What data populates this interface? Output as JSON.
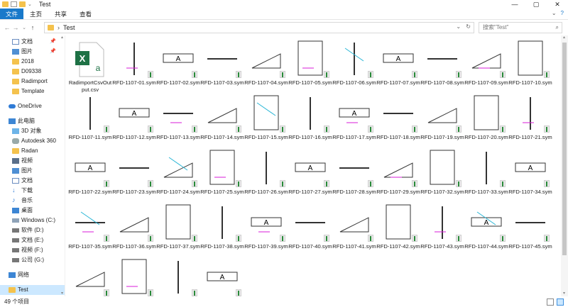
{
  "window": {
    "title": "Test",
    "controls": [
      "—",
      "▢",
      "✕"
    ]
  },
  "ribbon": {
    "tabs": [
      "文件",
      "主页",
      "共享",
      "查看"
    ],
    "right": [
      "⌄",
      "?"
    ]
  },
  "address": {
    "back": "←",
    "forward": "→",
    "history": "⌄",
    "up": "↑",
    "sep": "›",
    "path": "Test",
    "dropdown": "⌄",
    "refresh": "↻"
  },
  "search": {
    "placeholder": "搜索\"Test\"",
    "icon": "search-icon"
  },
  "sidebar": {
    "quick": [
      {
        "label": "文档",
        "pinned": true
      },
      {
        "label": "图片",
        "pinned": true
      },
      {
        "label": "2018"
      },
      {
        "label": "D09338"
      },
      {
        "label": "Radimport"
      },
      {
        "label": "Template"
      }
    ],
    "onedrive": "OneDrive",
    "pc": "此电脑",
    "pc_items": [
      "3D 对象",
      "Autodesk 360",
      "Radan",
      "视频",
      "图片",
      "文档",
      "下载",
      "音乐",
      "桌面",
      "Windows (C:)",
      "软件 (D:)",
      "文档 (E:)",
      "视频 (F:)",
      "公司 (G:)"
    ],
    "network": "网络",
    "selected": "Test"
  },
  "files": [
    "RadimportCsvOutput.csv",
    "RFD-1107-01.sym",
    "RFD-1107-02.sym",
    "RFD-1107-03.sym",
    "RFD-1107-04.sym",
    "RFD-1107-05.sym",
    "RFD-1107-06.sym",
    "RFD-1107-07.sym",
    "RFD-1107-08.sym",
    "RFD-1107-09.sym",
    "RFD-1107-10.sym",
    "RFD-1107-11.sym",
    "RFD-1107-12.sym",
    "RFD-1107-13.sym",
    "RFD-1107-14.sym",
    "RFD-1107-15.sym",
    "RFD-1107-16.sym",
    "RFD-1107-17.sym",
    "RFD-1107-18.sym",
    "RFD-1107-19.sym",
    "RFD-1107-20.sym",
    "RFD-1107-21.sym",
    "RFD-1107-22.sym",
    "RFD-1107-23.sym",
    "RFD-1107-24.sym",
    "RFD-1107-25.sym",
    "RFD-1107-26.sym",
    "RFD-1107-27.sym",
    "RFD-1107-28.sym",
    "RFD-1107-29.sym",
    "RFD-1107-32.sym",
    "RFD-1107-33.sym",
    "RFD-1107-34.sym",
    "RFD-1107-35.sym",
    "RFD-1107-36.sym",
    "RFD-1107-37.sym",
    "RFD-1107-38.sym",
    "RFD-1107-39.sym",
    "RFD-1107-40.sym",
    "RFD-1107-41.sym",
    "RFD-1107-42.sym",
    "RFD-1107-43.sym",
    "RFD-1107-44.sym",
    "RFD-1107-45.sym",
    "",
    "",
    "",
    ""
  ],
  "status": {
    "count": "49 个项目"
  },
  "colors": {
    "accent": "#1979ca",
    "selected": "#cce8ff",
    "magenta": "#d81bd8",
    "cyan": "#29b6d6"
  }
}
